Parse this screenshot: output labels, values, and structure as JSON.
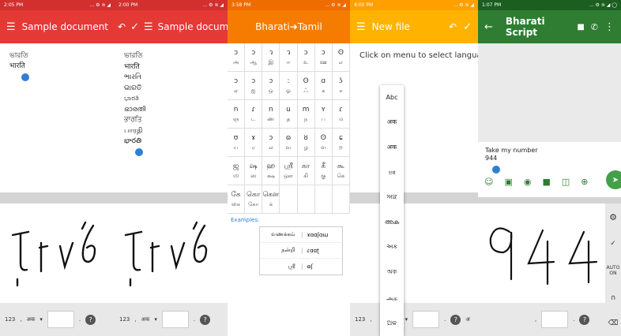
{
  "p1": {
    "status_time": "2:05 PM",
    "status_icons": "... ⚙ ≋ ◢",
    "title": "Sample document",
    "text_lines": [
      "ভারতি",
      "भारति"
    ],
    "kb": {
      "k123": "123",
      "comma": ",",
      "lang": "अक",
      "arrow": "▾",
      "period": "."
    }
  },
  "p2": {
    "status_time": "2:00 PM",
    "status_icons": "... ⚙ ≋ ◢",
    "title": "Sample docum...",
    "text_lines": [
      "ভারতি",
      "भारति",
      "ભારતિ",
      "ଭାରତି",
      "ಭಾರತಿ",
      "ഭാരതി",
      "ਭਾਰਤਿ",
      "பாரதி",
      "భారతి"
    ],
    "kb": {
      "k123": "123",
      "comma": ",",
      "lang": "अक",
      "arrow": "▾",
      "period": "."
    }
  },
  "p3": {
    "status_time": "3:58 PM",
    "status_icons": "... ⚙ ≋ ◢",
    "title": "Bharati➔Tamil",
    "grid": [
      [
        "ɔ",
        "அ"
      ],
      [
        "ɔ",
        "ஆ"
      ],
      [
        "ว",
        "இ"
      ],
      [
        "ว",
        "ஈ"
      ],
      [
        "ɔ",
        "உ"
      ],
      [
        "ɔ",
        "ஊ"
      ],
      [
        "ʘ",
        "எ"
      ],
      [
        "ɔ",
        "ஏ"
      ],
      [
        "ɔ",
        "ஐ"
      ],
      [
        "ɔ",
        "ஒ"
      ],
      [
        ":",
        "ஓ"
      ],
      [
        "ʘ",
        "ஃ"
      ],
      [
        "ɑ",
        "க"
      ],
      [
        "ʖ",
        "ச"
      ],
      [
        "n",
        "ஞ"
      ],
      [
        "ɾ",
        "ட"
      ],
      [
        "n",
        "ண"
      ],
      [
        "u",
        "த"
      ],
      [
        "m",
        "ந"
      ],
      [
        "ʏ",
        "ப"
      ],
      [
        "ɾ",
        "ம"
      ],
      [
        "ʊ",
        "ய"
      ],
      [
        "ɤ",
        "ர"
      ],
      [
        "ɔ",
        "ல"
      ],
      [
        "ɷ",
        "வ"
      ],
      [
        "ȣ",
        "ழ"
      ],
      [
        "ʘ",
        "ள"
      ],
      [
        "ɕ",
        "ற"
      ],
      [
        "ஜ",
        "ஶ"
      ],
      [
        "ஷ",
        "ஸ"
      ],
      [
        "ஹ",
        "க்ஷ"
      ],
      [
        "ஸ்ரீ",
        "ஔ"
      ],
      [
        "கா",
        "கி"
      ],
      [
        "கீ",
        "கு"
      ],
      [
        "கூ",
        "கெ"
      ],
      [
        "கே",
        "கை"
      ],
      [
        "கொ",
        "கோ"
      ],
      [
        "கௌ",
        "க்"
      ],
      [
        "",
        ""
      ],
      [
        "",
        ""
      ],
      [
        "",
        ""
      ],
      [
        "",
        ""
      ]
    ],
    "examples_label": "Examples:",
    "examples": [
      [
        "வணக்கம்",
        "ɤɑɑʃɑɯ"
      ],
      [
        "நன்றி",
        "ɾɑɑʈ"
      ],
      [
        "ஸ்ரீ",
        "ɷʃ"
      ]
    ]
  },
  "p4": {
    "status_time": "4:00 PM",
    "status_icons": "... ⚙ ≋ ◢",
    "title": "New file",
    "hint": "Click on menu to select language.",
    "menu": [
      "Abc",
      "अक",
      "अक",
      "ಅಕ",
      "ਅਕ",
      "അക",
      "અક",
      "অক",
      "அக",
      "ଅକ"
    ],
    "kb": {
      "k123": "123",
      "comma": ",",
      "lang": "अक",
      "arrow": "▾",
      "period": ".",
      "lang2": "अ"
    }
  },
  "p5": {
    "status_time": "1:07 PM",
    "status_icons": "... ⚙ ≋ ◢ ◯",
    "title": "Bharati Script",
    "msg": "Take my number",
    "typed": "944",
    "side_keys": [
      "⚙",
      "✓",
      "AUTO ON",
      "∩",
      "⌫"
    ],
    "kb": {
      "comma": ",",
      "period": "."
    }
  },
  "colors": {
    "red": "#e53935",
    "orange": "#f57c00",
    "amber": "#ffb300",
    "green": "#2e7d32"
  }
}
